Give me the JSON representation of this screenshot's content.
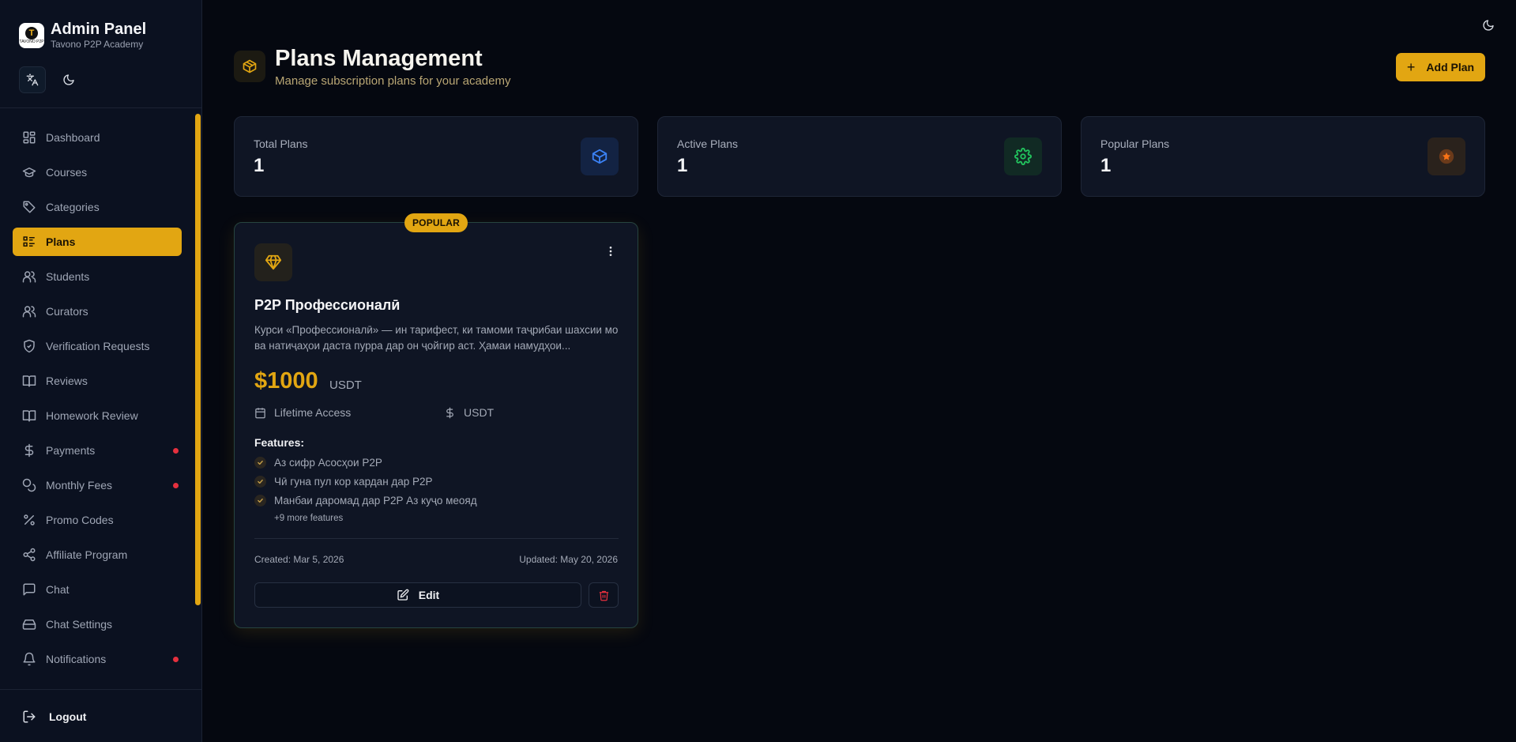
{
  "sidebar": {
    "brand_title": "Admin Panel",
    "brand_sub": "Tavono P2P Academy",
    "logo_text": "TAVONO P2P",
    "tools": {
      "translate_icon": "translate-icon",
      "theme_icon": "moon-icon"
    },
    "items": [
      {
        "label": "Dashboard",
        "icon": "dashboard-icon"
      },
      {
        "label": "Courses",
        "icon": "graduation-cap-icon"
      },
      {
        "label": "Categories",
        "icon": "tag-icon"
      },
      {
        "label": "Plans",
        "icon": "list-icon"
      },
      {
        "label": "Students",
        "icon": "users-icon"
      },
      {
        "label": "Curators",
        "icon": "users-icon"
      },
      {
        "label": "Verification Requests",
        "icon": "shield-check-icon"
      },
      {
        "label": "Reviews",
        "icon": "book-open-icon"
      },
      {
        "label": "Homework Review",
        "icon": "book-open-icon"
      },
      {
        "label": "Payments",
        "icon": "dollar-icon"
      },
      {
        "label": "Monthly Fees",
        "icon": "coins-icon"
      },
      {
        "label": "Promo Codes",
        "icon": "percent-icon"
      },
      {
        "label": "Affiliate Program",
        "icon": "share-icon"
      },
      {
        "label": "Chat",
        "icon": "chat-icon"
      },
      {
        "label": "Chat Settings",
        "icon": "hard-drive-icon"
      },
      {
        "label": "Notifications",
        "icon": "bell-icon"
      }
    ],
    "active": "Plans",
    "logout_label": "Logout"
  },
  "header": {
    "title": "Plans Management",
    "subtitle": "Manage subscription plans for your academy",
    "add_label": "Add Plan",
    "add_plus": "+"
  },
  "stats": [
    {
      "label": "Total Plans",
      "value": "1",
      "icon": "cube-icon",
      "color": "#3b82f6"
    },
    {
      "label": "Active Plans",
      "value": "1",
      "icon": "gear-icon",
      "color": "#22c55e"
    },
    {
      "label": "Popular Plans",
      "value": "1",
      "icon": "star-icon",
      "color": "#f97316"
    }
  ],
  "plan": {
    "badge": "POPULAR",
    "name": "P2P Профессионалӣ",
    "description": "Курси «Профессионалӣ» — ин тарифест, ки тамоми таҷрибаи шахсии мо ва натиҷаҳои даста пурра дар он ҷойгир аст. Ҳамаи намудҳои...",
    "price": "$1000",
    "currency": "USDT",
    "access": "Lifetime Access",
    "access_currency": "USDT",
    "features_title": "Features:",
    "features": [
      "Аз сифр Асосҳои P2P",
      "Чӣ гуна пул кор кардан дар P2P",
      "Манбаи даромад дар P2P Аз куҷо меояд"
    ],
    "more_features": "+9 more features",
    "created": "Created: Mar 5, 2026",
    "updated": "Updated: May 20, 2026",
    "edit_label": "Edit"
  },
  "colors": {
    "accent": "#e2a612",
    "danger": "#e5303e",
    "background": "#050810"
  }
}
